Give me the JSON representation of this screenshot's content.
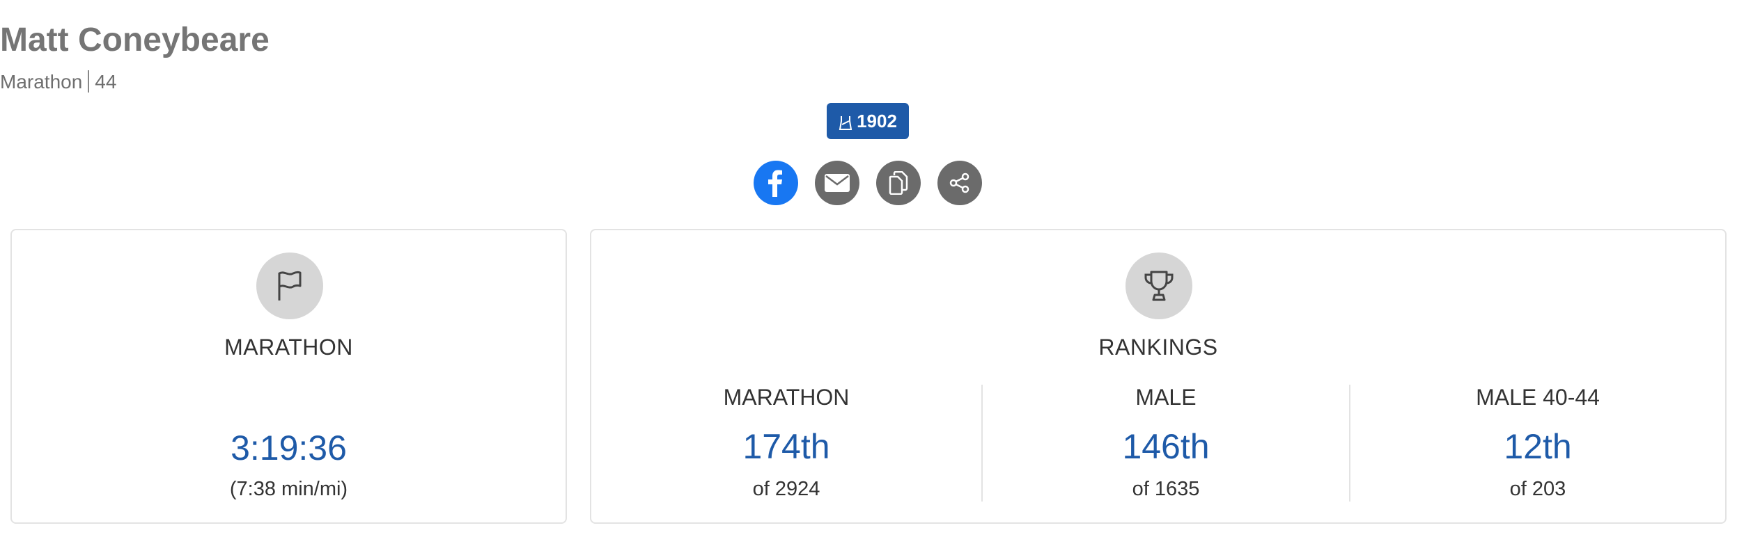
{
  "athlete": {
    "name": "Matt Coneybeare",
    "event": "Marathon",
    "age": "44",
    "bib": "1902"
  },
  "share": {
    "icons": [
      "facebook-icon",
      "email-icon",
      "copy-icon",
      "share-icon"
    ]
  },
  "result": {
    "title": "MARATHON",
    "time": "3:19:36",
    "pace": "(7:38 min/mi)",
    "icon": "flag-icon"
  },
  "rankings": {
    "title": "RANKINGS",
    "icon": "trophy-icon",
    "columns": [
      {
        "label": "MARATHON",
        "rank": "174th",
        "of": "of 2924"
      },
      {
        "label": "MALE",
        "rank": "146th",
        "of": "of 1635"
      },
      {
        "label": "MALE 40-44",
        "rank": "12th",
        "of": "of 203"
      }
    ]
  },
  "colors": {
    "accent": "#1e5aa8",
    "facebook": "#1877f2",
    "icon_bg": "#6b6b6b"
  }
}
